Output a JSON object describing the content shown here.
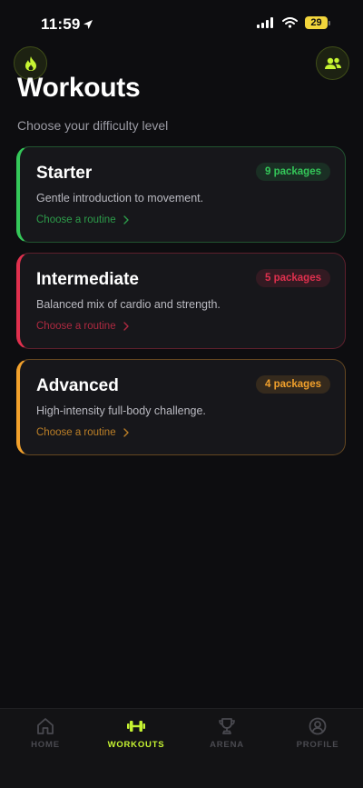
{
  "status_bar": {
    "time": "11:59",
    "battery": "29"
  },
  "header": {
    "title": "Workouts",
    "subtitle": "Choose your difficulty level",
    "left_icon": "flame-icon",
    "right_icon": "users-icon"
  },
  "cards": [
    {
      "title": "Starter",
      "description": "Gentle introduction to movement.",
      "badge": "9 packages",
      "link": "Choose a routine",
      "accent": "#34c759"
    },
    {
      "title": "Intermediate",
      "description": "Balanced mix of cardio and strength.",
      "badge": "5 packages",
      "link": "Choose a routine",
      "accent": "#e0304e"
    },
    {
      "title": "Advanced",
      "description": "High-intensity full-body challenge.",
      "badge": "4 packages",
      "link": "Choose a routine",
      "accent": "#f2a12c"
    }
  ],
  "tabs": [
    {
      "label": "HOME",
      "icon": "home-icon",
      "active": false
    },
    {
      "label": "WORKOUTS",
      "icon": "dumbbell-icon",
      "active": true
    },
    {
      "label": "ARENA",
      "icon": "trophy-icon",
      "active": false
    },
    {
      "label": "PROFILE",
      "icon": "profile-icon",
      "active": false
    }
  ],
  "colors": {
    "background": "#0d0d10",
    "brand_accent": "#c6f432",
    "starter": "#34c759",
    "intermediate": "#e0304e",
    "advanced": "#f2a12c"
  }
}
